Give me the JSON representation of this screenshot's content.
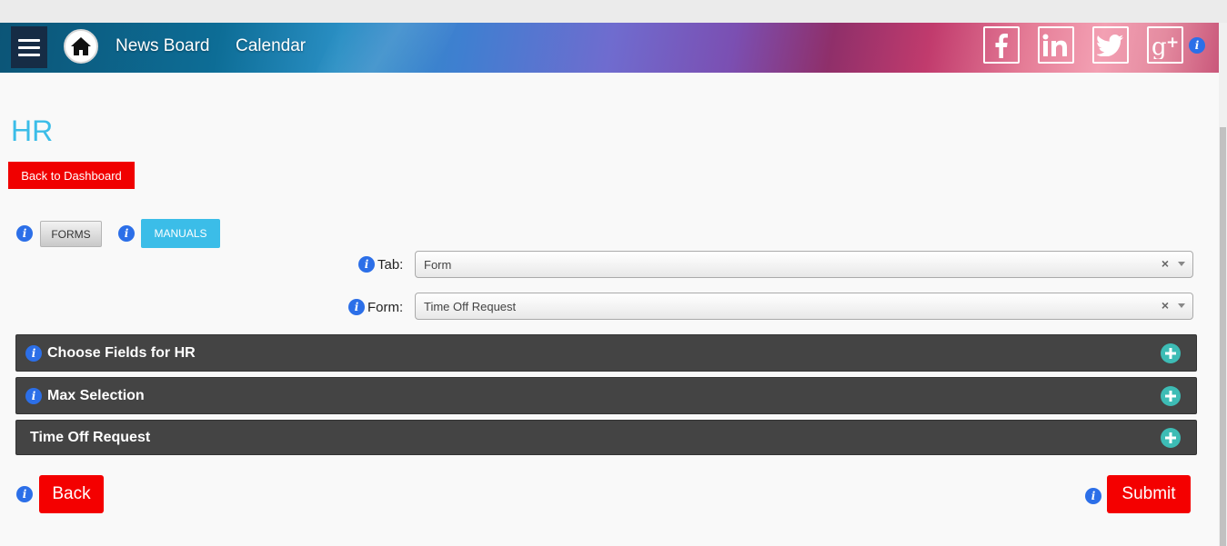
{
  "nav": {
    "menu_icon": "hamburger-menu-icon",
    "home_icon": "house-icon",
    "links": [
      "News Board",
      "Calendar"
    ],
    "social": [
      "facebook-icon",
      "linkedin-icon",
      "twitter-icon",
      "google-plus-icon"
    ],
    "colors": {
      "menu_bg": "#162c45",
      "accent_left": "#0c5577",
      "accent_mid": "#6f6ccf",
      "accent_right": "#f3a0b3"
    }
  },
  "page": {
    "title": "HR",
    "back_to_dashboard": "Back to Dashboard",
    "tabs": [
      {
        "label": "FORMS",
        "active": false
      },
      {
        "label": "MANUALS",
        "active": true
      }
    ]
  },
  "filters": {
    "tab": {
      "label": "Tab:",
      "value": "Form"
    },
    "form": {
      "label": "Form:",
      "value": "Time Off Request"
    }
  },
  "panels": [
    {
      "title": "Choose Fields for HR",
      "has_info": true
    },
    {
      "title": "Max Selection",
      "has_info": true
    },
    {
      "title": "Time Off Request",
      "has_info": false
    }
  ],
  "actions": {
    "back": "Back",
    "submit": "Submit"
  },
  "colors": {
    "title": "#3bbde8",
    "danger": "#f40000",
    "panel_bg": "#444444",
    "expand": "#3dbcb5",
    "info": "#2c6fe8"
  }
}
